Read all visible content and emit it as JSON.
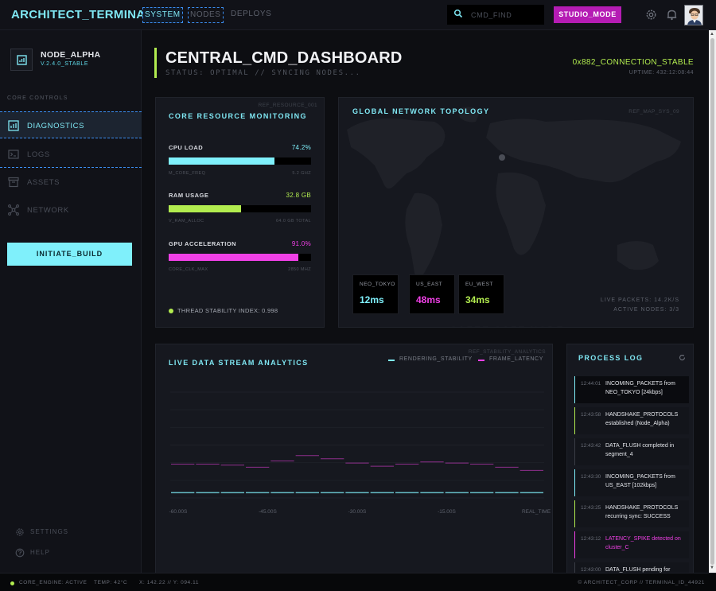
{
  "app": {
    "brand": "ARCHITECT_TERMINAL",
    "nav": [
      "SYSTEM",
      "NODES",
      "DEPLOYS"
    ],
    "search_placeholder": "CMD_FIND",
    "studio_button": "STUDIO_MODE",
    "icons": [
      "search-icon",
      "gear-icon",
      "bell-icon",
      "avatar"
    ]
  },
  "sidebar": {
    "node_name": "NODE_ALPHA",
    "node_version": "V.2.4.0_STABLE",
    "section_label": "CORE CONTROLS",
    "items": [
      {
        "label": "DIAGNOSTICS",
        "icon": "chart-icon",
        "active": true
      },
      {
        "label": "LOGS",
        "icon": "terminal-icon",
        "active": false
      },
      {
        "label": "ASSETS",
        "icon": "archive-icon",
        "active": false
      },
      {
        "label": "NETWORK",
        "icon": "network-icon",
        "active": false
      }
    ],
    "initiate_button": "INITIATE_BUILD",
    "footer": [
      {
        "label": "SETTINGS",
        "icon": "gear-icon"
      },
      {
        "label": "HELP",
        "icon": "help-icon"
      }
    ]
  },
  "header": {
    "title": "CENTRAL_CMD_DASHBOARD",
    "status": "STATUS: OPTIMAL // SYNCING NODES...",
    "connection": "0x882_CONNECTION_STABLE",
    "uptime": "UPTIME: 432:12:08:44"
  },
  "resources": {
    "ref": "REF_RESOURCE_001",
    "title": "CORE RESOURCE MONITORING",
    "metrics": [
      {
        "label": "CPU LOAD",
        "value": "74.2%",
        "fill": 0.742,
        "color": "#7ff0fb",
        "sub_left": "M_CORE_FREQ",
        "sub_right": "5.2 GHZ"
      },
      {
        "label": "RAM USAGE",
        "value": "32.8 GB",
        "fill": 0.51,
        "color": "#b2ec4f",
        "sub_left": "V_RAM_ALLOC",
        "sub_right": "64.0 GB TOTAL"
      },
      {
        "label": "GPU ACCELERATION",
        "value": "91.0%",
        "fill": 0.91,
        "color": "#f040e6",
        "sub_left": "CORE_CLK_MAX",
        "sub_right": "2850 MHZ"
      }
    ],
    "stability": "THREAD STABILITY INDEX: 0.998"
  },
  "topology": {
    "title": "GLOBAL NETWORK TOPOLOGY",
    "ref": "REF_MAP_SYS_09",
    "locations": [
      {
        "name": "NEO_TOKYO",
        "latency": "12ms",
        "color": "#7ff0fb"
      },
      {
        "name": "US_EAST",
        "latency": "48ms",
        "color": "#f040e6"
      },
      {
        "name": "EU_WEST",
        "latency": "34ms",
        "color": "#b2ec4f"
      }
    ],
    "live_packets": "LIVE PACKETS: 14.2K/S",
    "active_nodes": "ACTIVE NODES: 3/3"
  },
  "stream": {
    "title": "LIVE DATA STREAM ANALYTICS",
    "ref": "REF_STABILITY_ANALYTICS",
    "legend": [
      {
        "name": "RENDERING_STABILITY",
        "color": "#7ff0fb"
      },
      {
        "name": "FRAME_LATENCY",
        "color": "#f040e6"
      }
    ]
  },
  "chart_data": {
    "type": "line",
    "x_tick_labels": [
      "-60.00S",
      "-45.00S",
      "-30.00S",
      "-15.00S",
      "REAL_TIME"
    ],
    "series": [
      {
        "name": "RENDERING_STABILITY",
        "values": [
          0.05,
          0.05,
          0.05,
          0.05,
          0.05,
          0.05,
          0.05,
          0.05,
          0.05,
          0.05,
          0.05,
          0.05,
          0.05,
          0.05,
          0.05
        ]
      },
      {
        "name": "FRAME_LATENCY",
        "values": [
          0.32,
          0.32,
          0.31,
          0.29,
          0.35,
          0.4,
          0.37,
          0.33,
          0.3,
          0.32,
          0.34,
          0.33,
          0.32,
          0.29,
          0.26
        ]
      }
    ],
    "ylim": [
      0,
      1
    ],
    "grid": true
  },
  "log": {
    "title": "PROCESS LOG",
    "entries": [
      {
        "time": "12:44:01",
        "msg": "INCOMING_PACKETS from NEO_TOKYO [24kbps]",
        "accent": "#7ff0fb",
        "msg_color": "#e3e5ea",
        "highlight": true
      },
      {
        "time": "12:43:58",
        "msg": "HANDSHAKE_PROTOCOLS established (Node_Alpha)",
        "accent": "#b2ec4f",
        "msg_color": "#e3e5ea",
        "highlight": false
      },
      {
        "time": "12:43:42",
        "msg": "DATA_FLUSH completed in segment_4",
        "accent": "#3a3d46",
        "msg_color": "#e3e5ea",
        "highlight": false
      },
      {
        "time": "12:43:30",
        "msg": "INCOMING_PACKETS from US_EAST [102kbps]",
        "accent": "#7ff0fb",
        "msg_color": "#e3e5ea",
        "highlight": false
      },
      {
        "time": "12:43:25",
        "msg": "HANDSHAKE_PROTOCOLS recurring sync: SUCCESS",
        "accent": "#b2ec4f",
        "msg_color": "#e3e5ea",
        "highlight": false
      },
      {
        "time": "12:43:12",
        "msg": "LATENCY_SPIKE detected on cluster_C",
        "accent": "#f040e6",
        "msg_color": "#f040e6",
        "highlight": false
      },
      {
        "time": "12:43:00",
        "msg": "DATA_FLUSH pending for",
        "accent": "#3a3d46",
        "msg_color": "#e3e5ea",
        "highlight": false
      }
    ]
  },
  "statusbar": {
    "engine": "CORE_ENGINE: ACTIVE",
    "temp": "TEMP: 42°C",
    "coords": "X: 142.22 // Y: 094.11",
    "right": "© ARCHITECT_CORP // TERMINAL_ID_44921"
  },
  "colors": {
    "accent_cyan": "#7ff0fb",
    "accent_lime": "#b2ec4f",
    "accent_magenta": "#f040e6",
    "studio": "#b51cb4"
  }
}
